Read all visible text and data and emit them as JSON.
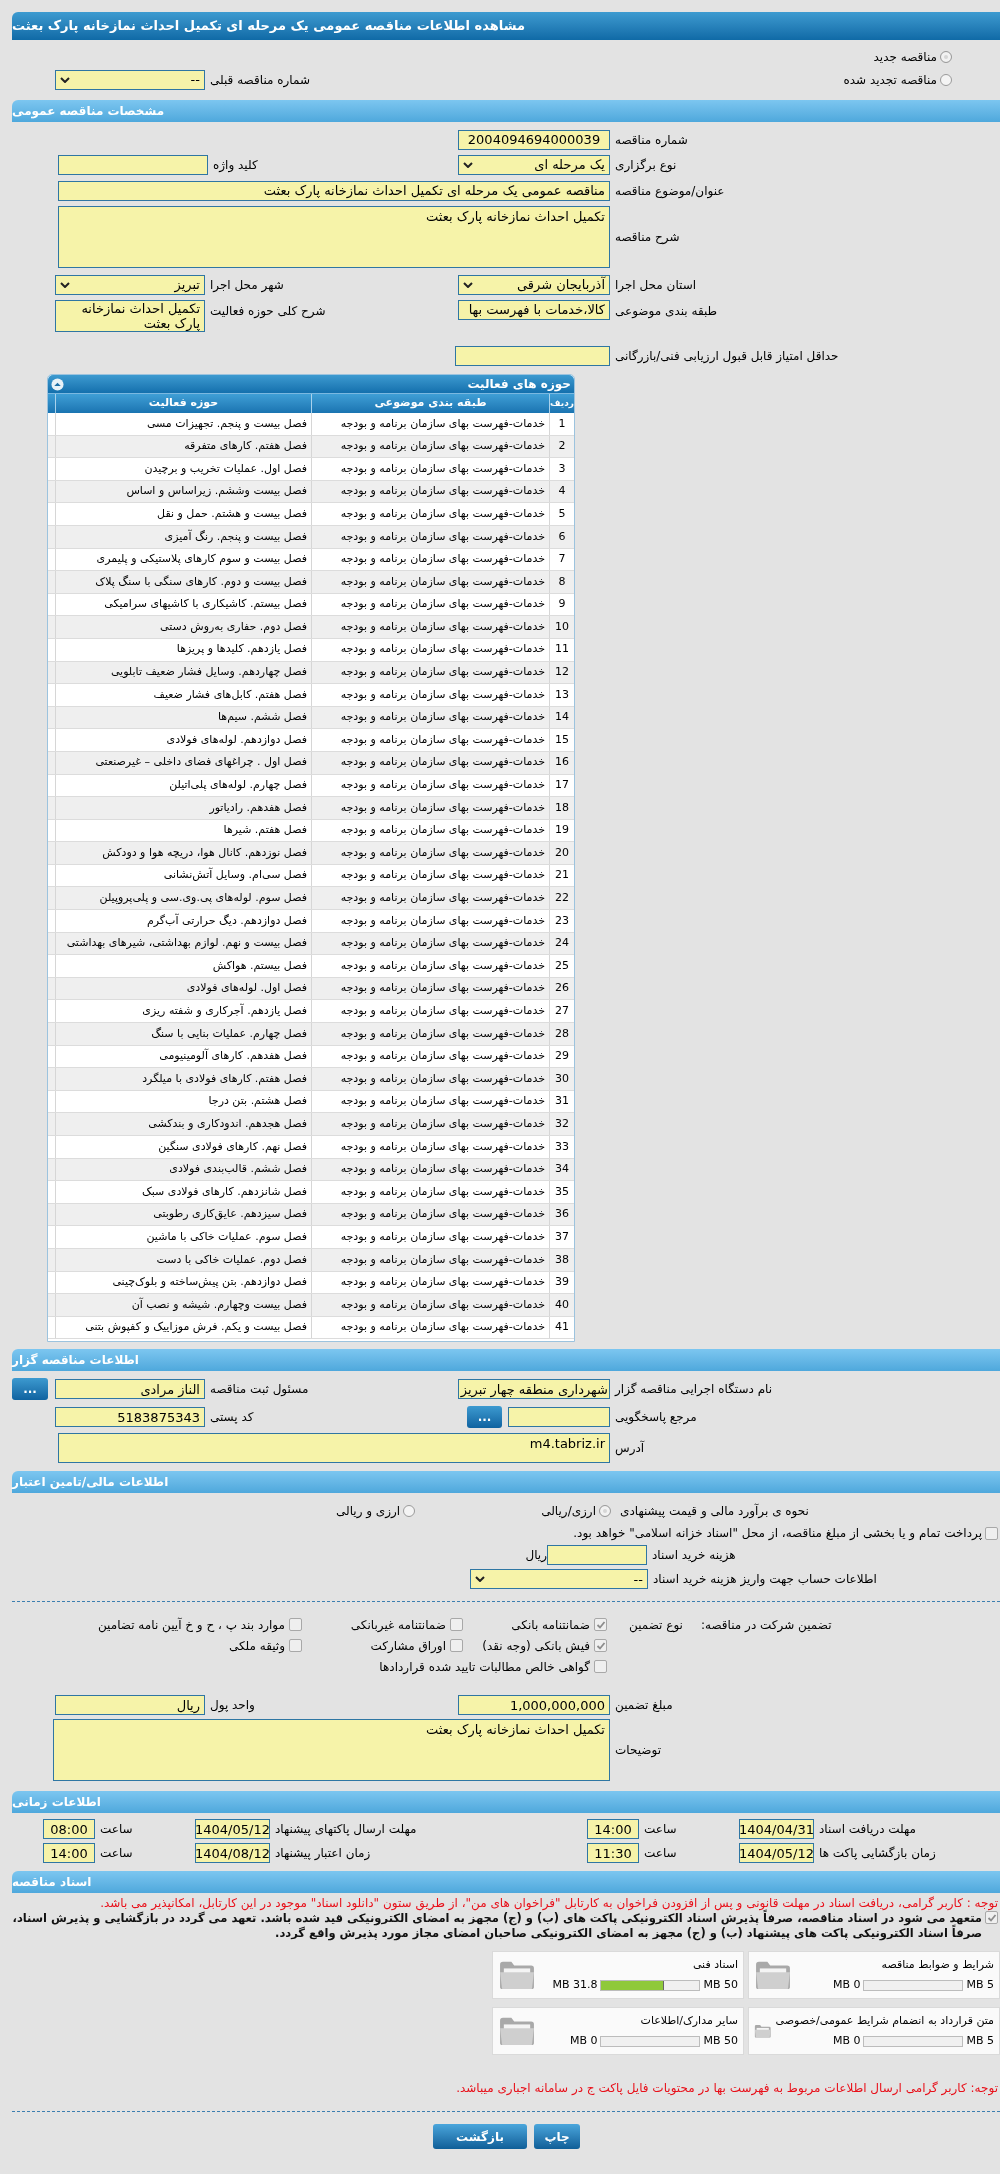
{
  "page_title": "مشاهده اطلاعات مناقصه عمومی یک مرحله ای تکمیل احداث نمازخانه پارک بعثت",
  "tender_status": [
    {
      "label": "مناقصه جدید",
      "selected": true
    },
    {
      "label": "مناقصه تجدید شده",
      "selected": false
    }
  ],
  "previous_tender": {
    "label": "شماره مناقصه قبلی",
    "value": "--"
  },
  "general": {
    "heading": "مشخصات مناقصه عمومی",
    "tender_number": {
      "label": "شماره مناقصه",
      "value": "2004094694000039"
    },
    "keyword": {
      "label": "کلید واژه"
    },
    "holding_type": {
      "label": "نوع برگزاری",
      "value": "یک مرحله ای"
    },
    "subject": {
      "label": "عنوان/موضوع مناقصه",
      "value": "مناقصه عمومی یک مرحله ای تکمیل احداث نمازخانه پارک بعثت"
    },
    "description": {
      "label": "شرح مناقصه",
      "value": "تکمیل احداث نمازخانه پارک بعثت"
    },
    "province": {
      "label": "استان محل اجرا",
      "value": "آذربایجان شرقی"
    },
    "city": {
      "label": "شهر محل اجرا",
      "value": "تبریز"
    },
    "classification": {
      "label": "طبقه بندی موضوعی",
      "value": "کالا،خدمات با فهرست بها"
    },
    "activity_scope": {
      "label": "شرح کلی حوزه فعالیت",
      "value": "تکمیل احداث نمازخانه پارک بعثت"
    },
    "min_score": {
      "label": "حداقل امتیاز قابل قبول ارزیابی فنی/بازرگانی"
    }
  },
  "activities": {
    "heading": "حوزه های فعالیت",
    "columns": [
      "ردیف",
      "طبقه بندی موضوعی",
      "حوزه فعالیت"
    ],
    "rows": [
      {
        "number": "1",
        "classification": "خدمات-فهرست بهای سازمان برنامه و بودجه",
        "activity": "فصل بیست و پنجم. تجهیزات مسی"
      },
      {
        "number": "2",
        "classification": "خدمات-فهرست بهای سازمان برنامه و بودجه",
        "activity": "فصل هفتم. کارهای متفرقه"
      },
      {
        "number": "3",
        "classification": "خدمات-فهرست بهای سازمان برنامه و بودجه",
        "activity": "فصل اول. عملیات تخریب و برچیدن"
      },
      {
        "number": "4",
        "classification": "خدمات-فهرست بهای سازمان برنامه و بودجه",
        "activity": "فصل بیست وششم. زیراساس و اساس"
      },
      {
        "number": "5",
        "classification": "خدمات-فهرست بهای سازمان برنامه و بودجه",
        "activity": "فصل بیست و هشتم. حمل و نقل"
      },
      {
        "number": "6",
        "classification": "خدمات-فهرست بهای سازمان برنامه و بودجه",
        "activity": "فصل بیست و پنجم. رنگ آمیزی"
      },
      {
        "number": "7",
        "classification": "خدمات-فهرست بهای سازمان برنامه و بودجه",
        "activity": "فصل بیست و سوم کارهای پلاستیکی و پلیمری"
      },
      {
        "number": "8",
        "classification": "خدمات-فهرست بهای سازمان برنامه و بودجه",
        "activity": "فصل بیست و دوم. کارهای سنگی با سنگ پلاک"
      },
      {
        "number": "9",
        "classification": "خدمات-فهرست بهای سازمان برنامه و بودجه",
        "activity": "فصل بیستم. کاشیکاری با کاشیهای سرامیکی"
      },
      {
        "number": "10",
        "classification": "خدمات-فهرست بهای سازمان برنامه و بودجه",
        "activity": "فصل دوم. حفاری به‌روش دستی"
      },
      {
        "number": "11",
        "classification": "خدمات-فهرست بهای سازمان برنامه و بودجه",
        "activity": "فصل یازدهم. کلیدها و پریزها"
      },
      {
        "number": "12",
        "classification": "خدمات-فهرست بهای سازمان برنامه و بودجه",
        "activity": "فصل چهاردهم. وسایل فشار ضعیف تابلویی"
      },
      {
        "number": "13",
        "classification": "خدمات-فهرست بهای سازمان برنامه و بودجه",
        "activity": "فصل هفتم. کابل‌های فشار ضعیف"
      },
      {
        "number": "14",
        "classification": "خدمات-فهرست بهای سازمان برنامه و بودجه",
        "activity": "فصل ششم. سیم‌ها"
      },
      {
        "number": "15",
        "classification": "خدمات-فهرست بهای سازمان برنامه و بودجه",
        "activity": "فصل دوازدهم. لوله‌های فولادی"
      },
      {
        "number": "16",
        "classification": "خدمات-فهرست بهای سازمان برنامه و بودجه",
        "activity": "فصل اول . چراغهای فضای داخلی – غیرصنعتی"
      },
      {
        "number": "17",
        "classification": "خدمات-فهرست بهای سازمان برنامه و بودجه",
        "activity": "فصل چهارم. لوله‌های پلی‌اتیلن"
      },
      {
        "number": "18",
        "classification": "خدمات-فهرست بهای سازمان برنامه و بودجه",
        "activity": "فصل هفدهم. رادیاتور"
      },
      {
        "number": "19",
        "classification": "خدمات-فهرست بهای سازمان برنامه و بودجه",
        "activity": "فصل هفتم. شیرها"
      },
      {
        "number": "20",
        "classification": "خدمات-فهرست بهای سازمان برنامه و بودجه",
        "activity": "فصل نوزدهم. کانال هوا، دریچه هوا و دودکش"
      },
      {
        "number": "21",
        "classification": "خدمات-فهرست بهای سازمان برنامه و بودجه",
        "activity": "فصل سی‌ام. وسایل آتش‌نشانی"
      },
      {
        "number": "22",
        "classification": "خدمات-فهرست بهای سازمان برنامه و بودجه",
        "activity": "فصل سوم. لوله‌های پی.وی.سی و پلی‌پروپیلن"
      },
      {
        "number": "23",
        "classification": "خدمات-فهرست بهای سازمان برنامه و بودجه",
        "activity": "فصل دوازدهم. دیگ حرارتی آب‌گرم"
      },
      {
        "number": "24",
        "classification": "خدمات-فهرست بهای سازمان برنامه و بودجه",
        "activity": "فصل بیست و نهم. لوازم بهداشتی، شیرهای بهداشتی"
      },
      {
        "number": "25",
        "classification": "خدمات-فهرست بهای سازمان برنامه و بودجه",
        "activity": "فصل بیستم. هواکش"
      },
      {
        "number": "26",
        "classification": "خدمات-فهرست بهای سازمان برنامه و بودجه",
        "activity": "فصل اول. لوله‌های فولادی"
      },
      {
        "number": "27",
        "classification": "خدمات-فهرست بهای سازمان برنامه و بودجه",
        "activity": "فصل یازدهم. آجرکاری و شفته ریزی"
      },
      {
        "number": "28",
        "classification": "خدمات-فهرست بهای سازمان برنامه و بودجه",
        "activity": "فصل چهارم. عملیات بنایی با سنگ"
      },
      {
        "number": "29",
        "classification": "خدمات-فهرست بهای سازمان برنامه و بودجه",
        "activity": "فصل هفدهم. کارهای آلومینیومی"
      },
      {
        "number": "30",
        "classification": "خدمات-فهرست بهای سازمان برنامه و بودجه",
        "activity": "فصل هفتم. کارهای فولادی با میلگرد"
      },
      {
        "number": "31",
        "classification": "خدمات-فهرست بهای سازمان برنامه و بودجه",
        "activity": "فصل هشتم. بتن درجا"
      },
      {
        "number": "32",
        "classification": "خدمات-فهرست بهای سازمان برنامه و بودجه",
        "activity": "فصل هجدهم. اندودکاری و بندکشی"
      },
      {
        "number": "33",
        "classification": "خدمات-فهرست بهای سازمان برنامه و بودجه",
        "activity": "فصل نهم. کارهای فولادی سنگین"
      },
      {
        "number": "34",
        "classification": "خدمات-فهرست بهای سازمان برنامه و بودجه",
        "activity": "فصل ششم. قالب‌بندی فولادی"
      },
      {
        "number": "35",
        "classification": "خدمات-فهرست بهای سازمان برنامه و بودجه",
        "activity": "فصل شانزدهم. کارهای فولادی سبک"
      },
      {
        "number": "36",
        "classification": "خدمات-فهرست بهای سازمان برنامه و بودجه",
        "activity": "فصل سیزدهم. عایق‌کاری رطوبتی"
      },
      {
        "number": "37",
        "classification": "خدمات-فهرست بهای سازمان برنامه و بودجه",
        "activity": "فصل سوم. عملیات خاکی با ماشین"
      },
      {
        "number": "38",
        "classification": "خدمات-فهرست بهای سازمان برنامه و بودجه",
        "activity": "فصل دوم. عملیات خاکی با دست"
      },
      {
        "number": "39",
        "classification": "خدمات-فهرست بهای سازمان برنامه و بودجه",
        "activity": "فصل دوازدهم. بتن پیش‌ساخته و بلوک‌چینی"
      },
      {
        "number": "40",
        "classification": "خدمات-فهرست بهای سازمان برنامه و بودجه",
        "activity": "فصل بیست وچهارم. شیشه و نصب آن"
      },
      {
        "number": "41",
        "classification": "خدمات-فهرست بهای سازمان برنامه و بودجه",
        "activity": "فصل بیست و یکم. فرش موزاییک و کفپوش بتنی"
      }
    ]
  },
  "organizer": {
    "heading": "اطلاعات مناقصه گزار",
    "agency": {
      "label": "نام دستگاه اجرایی مناقصه گزار",
      "value": "شهرداری منطقه چهار تبریز"
    },
    "registrar": {
      "label": "مسئول ثبت مناقصه",
      "value": "الناز مرادی",
      "button": "..."
    },
    "reference": {
      "label": "مرجع پاسخگویی",
      "button": "..."
    },
    "postal_code": {
      "label": "کد پستی",
      "value": "5183875343"
    },
    "address": {
      "label": "آدرس",
      "value": "m4.tabriz.ir"
    }
  },
  "finance": {
    "heading": "اطلاعات مالی/تامین اعتبار",
    "estimate": {
      "label": "نحوه ی برآورد مالی و قیمت پیشنهادی",
      "options": [
        {
          "label": "ارزی/ریالی",
          "selected": true
        },
        {
          "label": "ارزی و ریالی",
          "selected": false
        }
      ]
    },
    "treasury": {
      "label": "پرداخت تمام و یا بخشی از مبلغ مناقصه، از محل \"اسناد خزانه اسلامی\" خواهد بود.",
      "checked": false
    },
    "doc_cost": {
      "label": "هزینه خرید اسناد",
      "unit": "ریال"
    },
    "account": {
      "label": "اطلاعات حساب جهت واریز هزینه خرید اسناد",
      "value": "--"
    },
    "guarantee": {
      "label": "تضمین شرکت در مناقصه:",
      "type_label": "نوع تضمین",
      "options": [
        {
          "label": "ضمانتنامه بانکی",
          "checked": true
        },
        {
          "label": "ضمانتنامه غیربانکی",
          "checked": false
        },
        {
          "label": "موارد بند پ ، ح و خ آیین نامه تضامین",
          "checked": false
        },
        {
          "label": "فیش بانکی (وجه نقد)",
          "checked": true
        },
        {
          "label": "اوراق مشارکت",
          "checked": false
        },
        {
          "label": "وثیقه ملکی",
          "checked": false
        },
        {
          "label": "گواهی خالص مطالبات تایید شده قراردادها",
          "checked": false
        }
      ]
    },
    "amount": {
      "label": "مبلغ تضمین",
      "value": "1,000,000,000"
    },
    "currency": {
      "label": "واحد پول",
      "value": "ریال"
    },
    "notes": {
      "label": "توضیحات",
      "value": "تکمیل احداث نمازخانه پارک بعثت"
    }
  },
  "timing": {
    "heading": "اطلاعات زمانی",
    "items": [
      {
        "label": "مهلت دریافت اسناد",
        "date": "1404/04/31",
        "time_label": "ساعت",
        "time": "14:00"
      },
      {
        "label": "مهلت ارسال پاکتهای پیشنهاد",
        "date": "1404/05/12",
        "time_label": "ساعت",
        "time": "08:00"
      },
      {
        "label": "زمان بازگشایی پاکت ها",
        "date": "1404/05/12",
        "time_label": "ساعت",
        "time": "11:30"
      },
      {
        "label": "زمان اعتبار پیشنهاد",
        "date": "1404/08/12",
        "time_label": "ساعت",
        "time": "14:00"
      }
    ]
  },
  "documents": {
    "heading": "اسناد مناقصه",
    "notice": "توجه : کاربر گرامی، دریافت اسناد در مهلت قانونی و پس از افزودن فراخوان به کارتابل \"فراخوان های من\"، از طریق ستون \"دانلود اسناد\" موجود در این کارتابل، امکانپذیر می باشد.",
    "commitment": {
      "text": "متعهد می شود در اسناد مناقصه، صرفاً پذیرش اسناد الکترونیکی پاکت های (ب) و (ج) مجهز به امضای الکترونیکی قید شده باشد. تعهد می گردد در بازگشایی و پذیرش اسناد، صرفاً اسناد الکترونیکی پاکت های پیشنهاد (ب) و (ج) مجهز به امضای الکترونیکی صاحبان امضای مجاز مورد پذیرش واقع گردد.",
      "checked": true
    },
    "files": [
      {
        "title": "شرایط و ضوابط مناقصه",
        "used": "0 MB",
        "capacity": "5 MB",
        "level": 0
      },
      {
        "title": "اسناد فنی",
        "used": "31.8 MB",
        "capacity": "50 MB",
        "level": 0.636
      },
      {
        "title": "متن قرارداد به انضمام شرایط عمومی/خصوصی",
        "used": "0 MB",
        "capacity": "5 MB",
        "level": 0
      },
      {
        "title": "سایر مدارک/اطلاعات",
        "used": "0 MB",
        "capacity": "50 MB",
        "level": 0
      }
    ],
    "footer_note": "توجه: کاربر گرامی ارسال اطلاعات مربوط به فهرست بها در محتویات فایل پاکت ج در سامانه اجباری میباشد."
  },
  "buttons": [
    "چاپ",
    "بازگشت"
  ]
}
